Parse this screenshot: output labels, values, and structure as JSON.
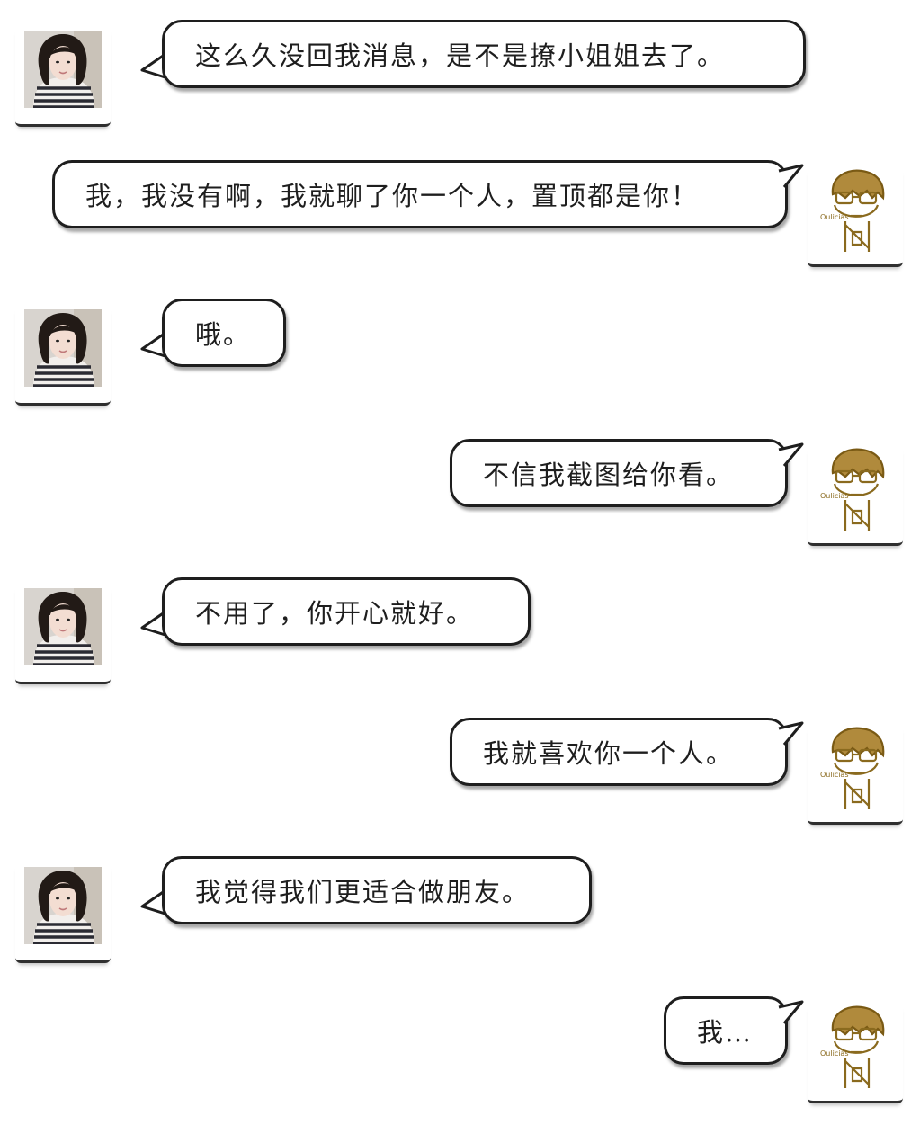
{
  "conversation": {
    "messages": [
      {
        "sender": "her",
        "text": "这么久没回我消息，是不是撩小姐姐去了。"
      },
      {
        "sender": "me",
        "text": "我，我没有啊，我就聊了你一个人，置顶都是你！"
      },
      {
        "sender": "her",
        "text": "哦。"
      },
      {
        "sender": "me",
        "text": "不信我截图给你看。"
      },
      {
        "sender": "her",
        "text": "不用了，你开心就好。"
      },
      {
        "sender": "me",
        "text": "我就喜欢你一个人。"
      },
      {
        "sender": "her",
        "text": "我觉得我们更适合做朋友。"
      },
      {
        "sender": "me",
        "text": "我…"
      }
    ]
  },
  "avatars": {
    "her": {
      "icon": "girl-photo-avatar"
    },
    "me": {
      "icon": "sketch-boy-avatar",
      "signature": "Oulicias"
    }
  },
  "colors": {
    "bubble_border": "#1e1e1e",
    "sketch_ink": "#8a6a1e",
    "background": "#ffffff"
  }
}
